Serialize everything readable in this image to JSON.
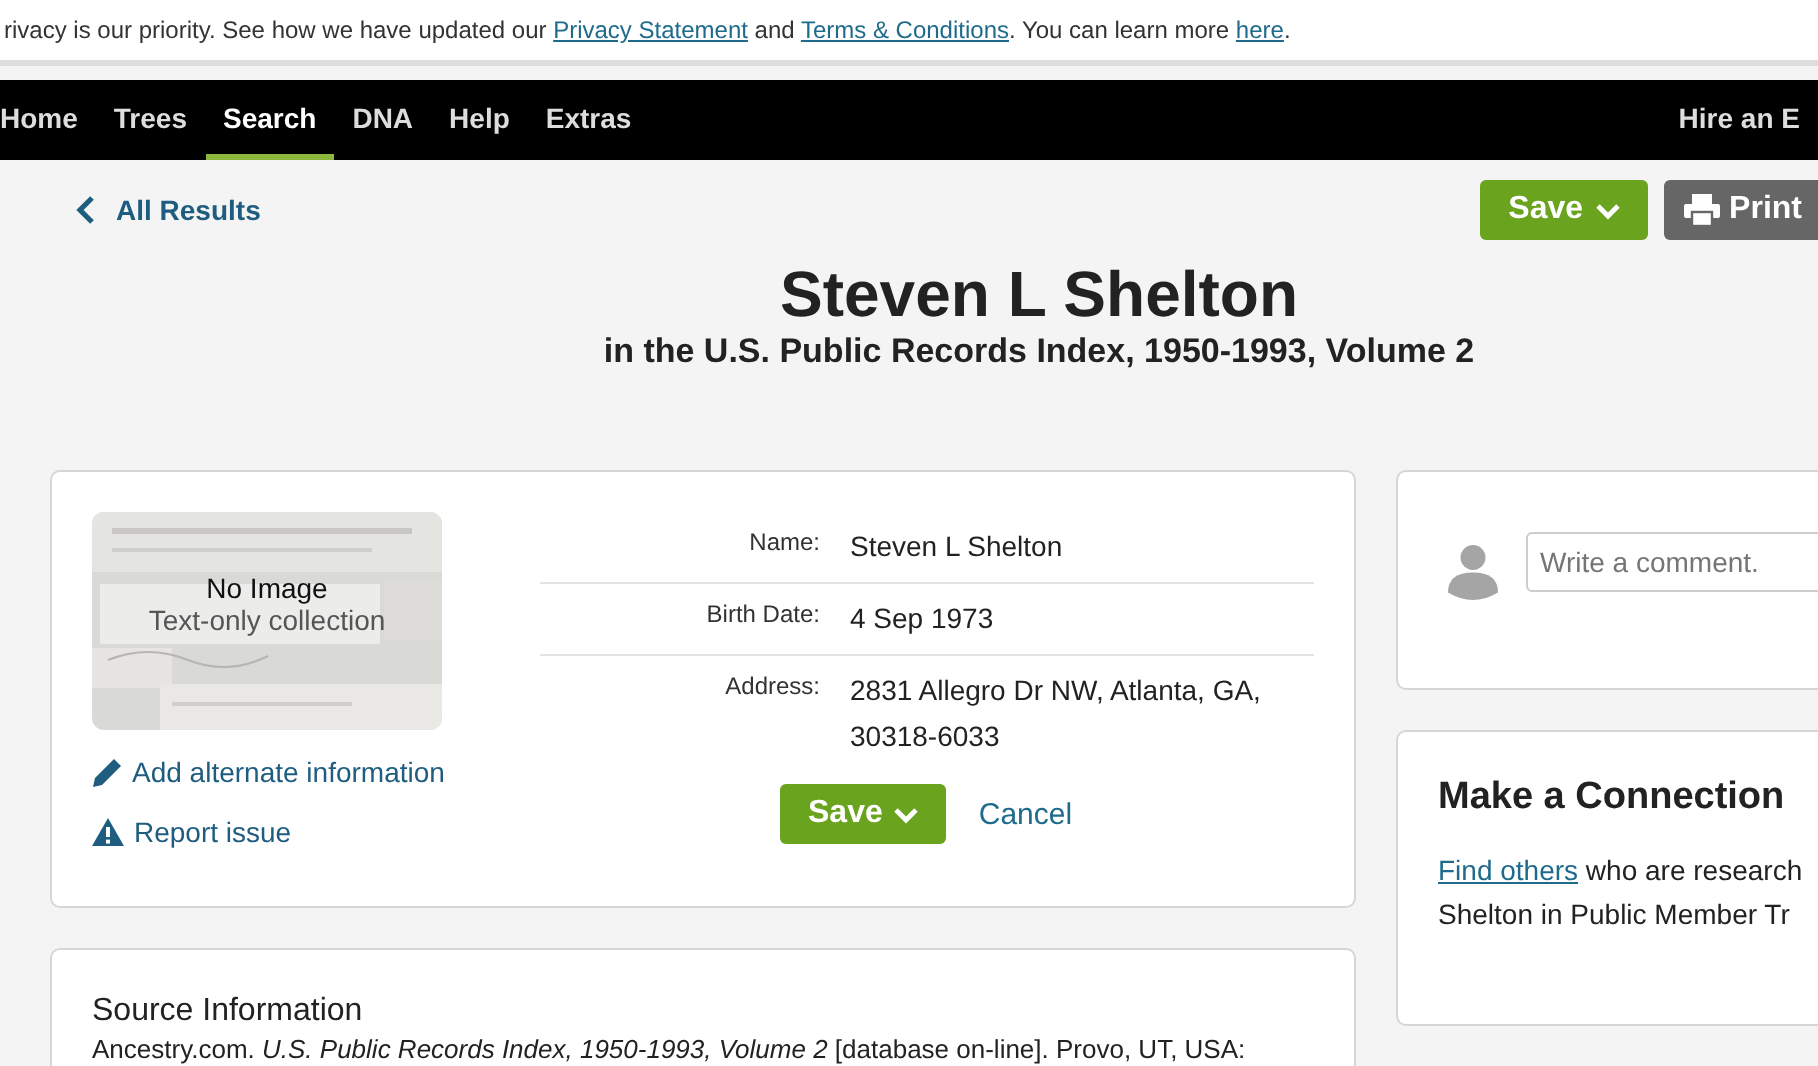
{
  "notice": {
    "text": "rivacy is our priority. See how we have updated our ",
    "links": [
      "Privacy Statement",
      "Terms & Conditions",
      "here"
    ],
    "joiners": [
      " and ",
      ". You can learn more "
    ],
    "end": "."
  },
  "nav": [
    {
      "label": "Home",
      "selected": false
    },
    {
      "label": "Trees",
      "selected": false
    },
    {
      "label": "Search",
      "selected": true
    },
    {
      "label": "DNA",
      "selected": false
    },
    {
      "label": "Help",
      "selected": false
    },
    {
      "label": "Extras",
      "selected": false
    }
  ],
  "nav_right": "Hire an E",
  "back_link": "All Results",
  "header_buttons": [
    {
      "kind": "save",
      "label": "Save"
    },
    {
      "kind": "print",
      "label": "Print"
    }
  ],
  "title": "Steven L Shelton",
  "subtitle": "in the U.S. Public Records Index, 1950-1993, Volume 2",
  "record": {
    "image": {
      "title": "No Image",
      "caption": "Text-only collection"
    },
    "fields": [
      {
        "label": "Name:",
        "value": "Steven L Shelton"
      },
      {
        "label": "Birth Date:",
        "value": "4 Sep 1973"
      },
      {
        "label": "Address:",
        "value": "2831 Allegro Dr NW, Atlanta, GA, 30318-6033"
      }
    ],
    "links": [
      {
        "kind": "edit",
        "label": "Add alternate information"
      },
      {
        "kind": "warning",
        "label": "Report issue"
      }
    ],
    "save": "Save",
    "cancel": "Cancel"
  },
  "comment": {
    "placeholder": "Write a comment."
  },
  "connection": {
    "title": "Make a Connection",
    "link": "Find others",
    "text": " who are research",
    "text_2": "Shelton in Public Member Tr"
  },
  "source": {
    "title": "Source Information",
    "text": "Ancestry.com. *U.S. Public Records Index, 1950-1993, Volume 2* [database on-line]. Provo, UT, USA:"
  }
}
